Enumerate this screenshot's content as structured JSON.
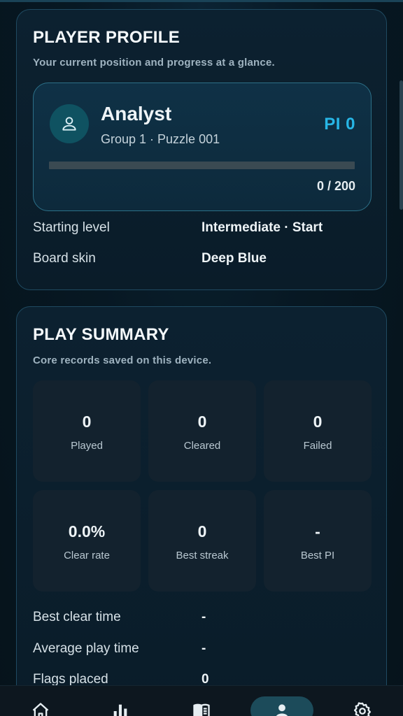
{
  "profile": {
    "title": "PLAYER PROFILE",
    "subtitle": "Your current position and progress at a glance.",
    "player_name": "Analyst",
    "player_meta": "Group 1 · Puzzle 001",
    "pi_label": "PI 0",
    "progress": {
      "current": 0,
      "total": 200,
      "text": "0 / 200"
    },
    "rows": [
      {
        "label": "Starting level",
        "value": "Intermediate · Start"
      },
      {
        "label": "Board skin",
        "value": "Deep Blue"
      }
    ]
  },
  "summary": {
    "title": "PLAY SUMMARY",
    "subtitle": "Core records saved on this device.",
    "stats": [
      {
        "value": "0",
        "label": "Played"
      },
      {
        "value": "0",
        "label": "Cleared"
      },
      {
        "value": "0",
        "label": "Failed"
      },
      {
        "value": "0.0%",
        "label": "Clear rate"
      },
      {
        "value": "0",
        "label": "Best streak"
      },
      {
        "value": "-",
        "label": "Best PI"
      }
    ],
    "rows": [
      {
        "label": "Best clear time",
        "value": "-"
      },
      {
        "label": "Average play time",
        "value": "-"
      },
      {
        "label": "Flags placed",
        "value": "0"
      }
    ]
  },
  "nav": {
    "items": [
      {
        "icon": "home-icon"
      },
      {
        "icon": "bar-chart-icon"
      },
      {
        "icon": "book-icon"
      },
      {
        "icon": "person-icon",
        "active": true
      },
      {
        "icon": "gear-icon"
      }
    ]
  },
  "colors": {
    "accent": "#27b6e6",
    "background": "#06141d",
    "card_border": "#1f4a61",
    "active_nav": "#1c4b5a"
  }
}
